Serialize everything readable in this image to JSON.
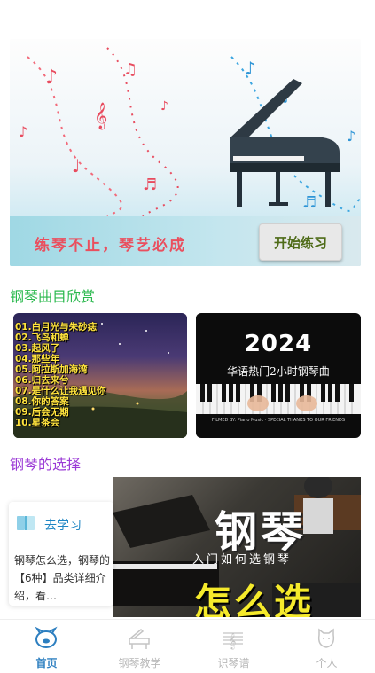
{
  "banner": {
    "slogan": "练琴不止，琴艺必成",
    "cta_label": "开始练习"
  },
  "sections": {
    "repertoire_title": "钢琴曲目欣赏",
    "choice_title": "钢琴的选择"
  },
  "cards": {
    "left_songs": [
      "01.白月光与朱砂痣",
      "02.飞鸟和蝉",
      "03.起风了",
      "04.那些年",
      "05.阿拉斯加海湾",
      "06.归去来兮",
      "07.是什么让我遇见你",
      "08.你的答案",
      "09.后会无期",
      "10.星茶会"
    ],
    "right_year": "2024",
    "right_subtitle": "华语热门2小时钢琴曲",
    "right_credits": "FILMED BY: Piano Music · SPECIAL THANKS TO OUR FRIENDS"
  },
  "choice": {
    "study_label": "去学习",
    "study_text": "钢琴怎么选，钢琴的【6种】品类详细介绍，看…",
    "photo_word": "钢琴",
    "photo_sub": "入门如何选钢琴",
    "photo_big": "怎么选"
  },
  "tabs": [
    {
      "label": "首页",
      "icon": "home-icon",
      "active": true
    },
    {
      "label": "钢琴教学",
      "icon": "piano-icon",
      "active": false
    },
    {
      "label": "识琴谱",
      "icon": "score-icon",
      "active": false
    },
    {
      "label": "个人",
      "icon": "profile-icon",
      "active": false
    }
  ],
  "colors": {
    "accent": "#2d7fc0",
    "section1": "#2bb94e",
    "section2": "#9b3bd6",
    "slogan": "#ea4f5e"
  }
}
